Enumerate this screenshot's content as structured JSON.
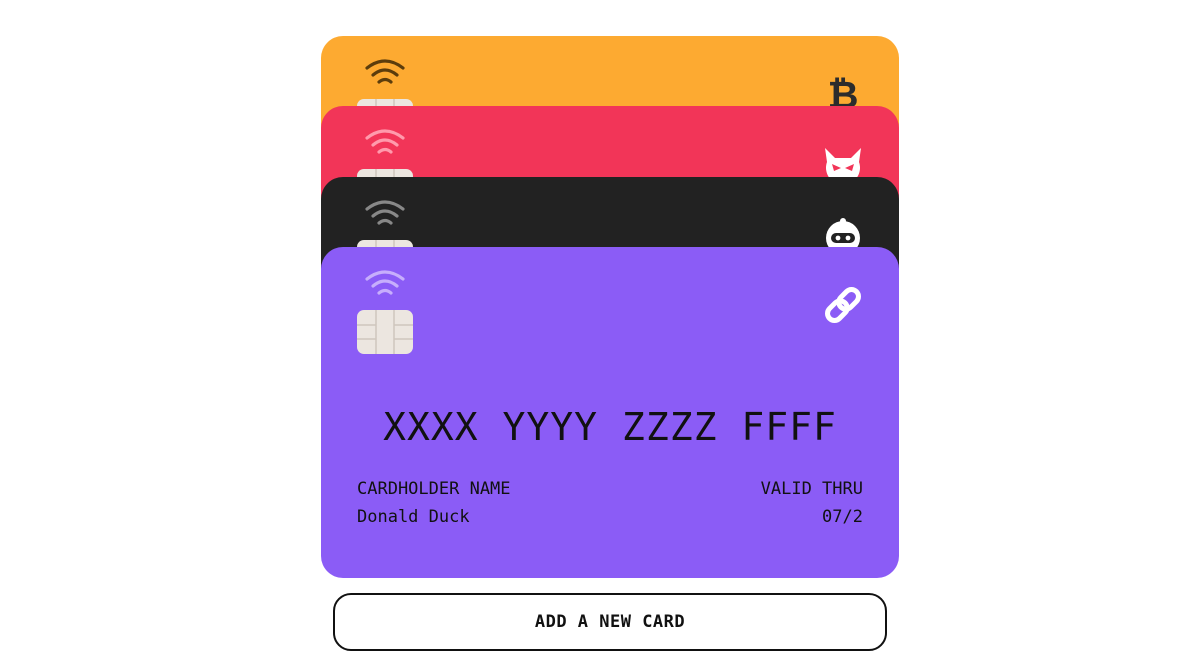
{
  "cards": [
    {
      "color": "#fdaa31",
      "wifi_color": "#5c3d0c",
      "logo": "bitcoin-icon",
      "logo_color": "#2c2c2c"
    },
    {
      "color": "#f23558",
      "wifi_color": "#ff9aac",
      "logo": "devil-icon",
      "logo_color": "#ffffff"
    },
    {
      "color": "#222222",
      "wifi_color": "#888888",
      "logo": "robot-icon",
      "logo_color": "#ffffff"
    },
    {
      "color": "#8b5cf6",
      "wifi_color": "#c7aefc",
      "logo": "link-icon",
      "logo_color": "#ffffff",
      "number": "XXXX YYYY ZZZZ FFFF",
      "holder_label": "CARDHOLDER NAME",
      "holder_name": "Donald Duck",
      "valid_label": "VALID THRU",
      "valid_value": "07/2"
    }
  ],
  "add_button": {
    "label": "ADD A NEW CARD"
  }
}
